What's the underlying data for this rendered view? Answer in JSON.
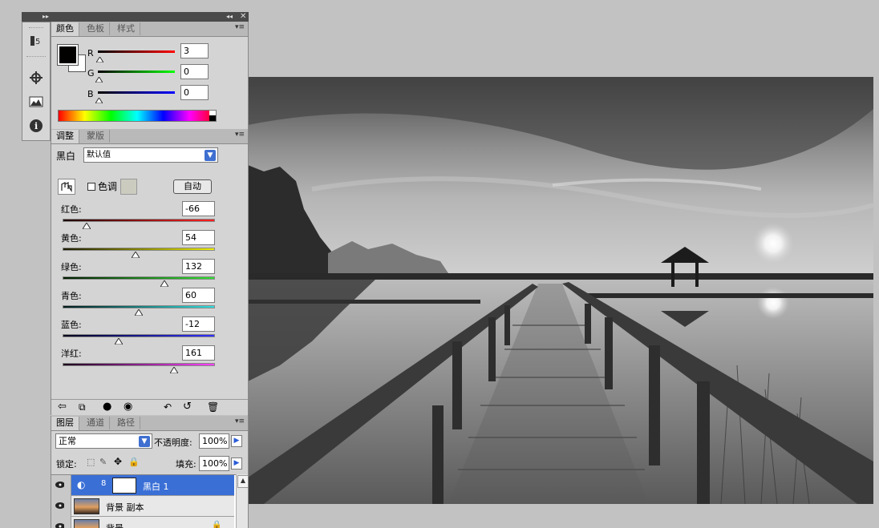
{
  "color_panel": {
    "tabs": [
      "颜色",
      "色板",
      "样式"
    ],
    "active_tab": 0,
    "channels": [
      {
        "label": "R",
        "value": "3",
        "color": "#d01010"
      },
      {
        "label": "G",
        "value": "0",
        "color": "#10b010"
      },
      {
        "label": "B",
        "value": "0",
        "color": "#1010c0"
      }
    ],
    "foreground": "#030000",
    "background": "#ffffff"
  },
  "adjust_panel": {
    "tabs": [
      "调整",
      "蒙版"
    ],
    "active_tab": 0,
    "adjustment_name": "黑白",
    "preset_value": "默认值",
    "tint_label": "色调",
    "auto_button": "自动",
    "sliders": [
      {
        "label": "红色:",
        "value": "-66",
        "level": 0.16,
        "gradient": [
          "#1a0000",
          "#ff2020"
        ]
      },
      {
        "label": "黄色:",
        "value": "54",
        "level": 0.48,
        "gradient": [
          "#1a1a00",
          "#f0f000"
        ]
      },
      {
        "label": "绿色:",
        "value": "132",
        "level": 0.67,
        "gradient": [
          "#001a00",
          "#30e030"
        ]
      },
      {
        "label": "青色:",
        "value": "60",
        "level": 0.5,
        "gradient": [
          "#001a1a",
          "#30e0e0"
        ]
      },
      {
        "label": "蓝色:",
        "value": "-12",
        "level": 0.37,
        "gradient": [
          "#00001a",
          "#3030ff"
        ]
      },
      {
        "label": "洋红:",
        "value": "161",
        "level": 0.73,
        "gradient": [
          "#1a001a",
          "#ff40ff"
        ]
      }
    ]
  },
  "layers_panel": {
    "tabs": [
      "图层",
      "通道",
      "路径"
    ],
    "active_tab": 0,
    "blend_mode": "正常",
    "opacity_label": "不透明度:",
    "opacity_value": "100%",
    "lock_label": "锁定:",
    "fill_label": "填充:",
    "fill_value": "100%",
    "layers": [
      {
        "name": "黑白 1",
        "selected": true
      },
      {
        "name": "背景 副本",
        "selected": false
      },
      {
        "name": "背景",
        "selected": false
      }
    ]
  },
  "dock_icons": [
    "history-icon",
    "navigator-icon",
    "histogram-icon",
    "info-icon"
  ]
}
